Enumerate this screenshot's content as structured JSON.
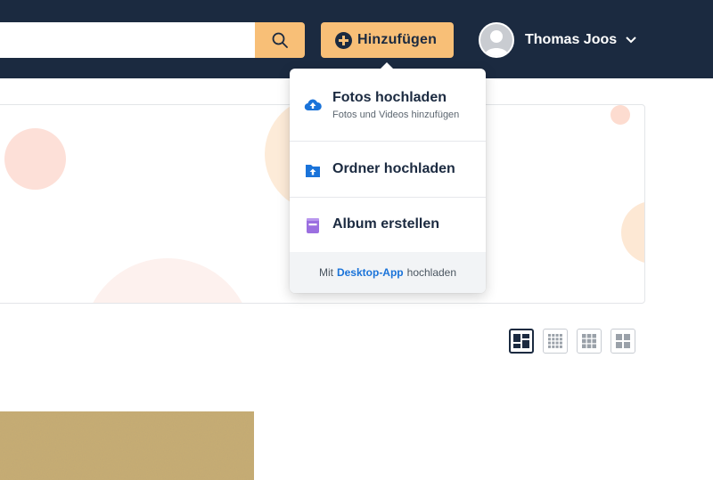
{
  "header": {
    "search": {
      "value": "",
      "placeholder": ""
    },
    "search_icon": "search-icon",
    "add_button": {
      "label": "Hinzufügen",
      "icon": "plus-circle-icon"
    },
    "user": {
      "name": "Thomas Joos",
      "icon": "avatar-icon"
    }
  },
  "dropdown": {
    "items": [
      {
        "title": "Fotos hochladen",
        "subtitle": "Fotos und Videos hinzufügen",
        "icon": "cloud-upload-icon"
      },
      {
        "title": "Ordner hochladen",
        "icon": "folder-upload-icon"
      },
      {
        "title": "Album erstellen",
        "icon": "album-icon"
      }
    ],
    "footer": {
      "prefix": "Mit",
      "link": "Desktop-App",
      "suffix": "hochladen"
    }
  },
  "view_modes": [
    "layout-mosaic-icon",
    "layout-small-grid-icon",
    "layout-medium-grid-icon",
    "layout-large-grid-icon"
  ],
  "colors": {
    "header_bg": "#1b2a40",
    "accent": "#f8bf77",
    "link": "#1a73d9",
    "upload_icon": "#1a73d9",
    "album_icon": "#9b6fe0"
  }
}
